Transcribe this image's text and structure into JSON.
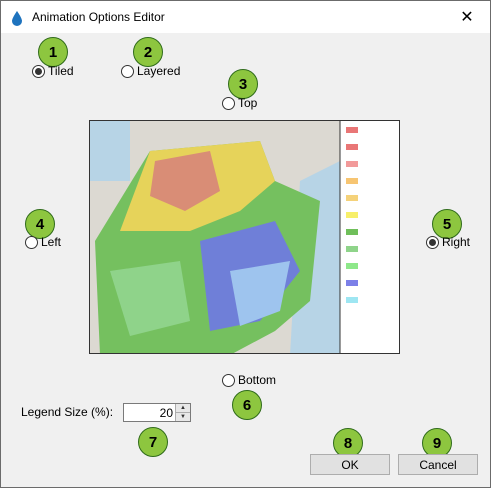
{
  "window": {
    "title": "Animation Options Editor",
    "close_label": "✕"
  },
  "placement_options": [
    {
      "label": "Tiled",
      "selected": true
    },
    {
      "label": "Layered",
      "selected": false
    }
  ],
  "legend_position": [
    {
      "label": "Top",
      "selected": false
    },
    {
      "label": "Left",
      "selected": false
    },
    {
      "label": "Right",
      "selected": true
    },
    {
      "label": "Bottom",
      "selected": false
    }
  ],
  "legend_size": {
    "label": "Legend Size (%):",
    "value": "20"
  },
  "buttons": {
    "ok": "OK",
    "cancel": "Cancel"
  },
  "callouts": [
    "1",
    "2",
    "3",
    "4",
    "5",
    "6",
    "7",
    "8",
    "9"
  ],
  "preview": {
    "legend_colors": [
      "#e97676",
      "#e97676",
      "#f29a9a",
      "#f7c572",
      "#f5d27a",
      "#f7ef6a",
      "#6fbf5a",
      "#8fd48a",
      "#8ee88a",
      "#7c80e8",
      "#9ee6f2"
    ]
  }
}
